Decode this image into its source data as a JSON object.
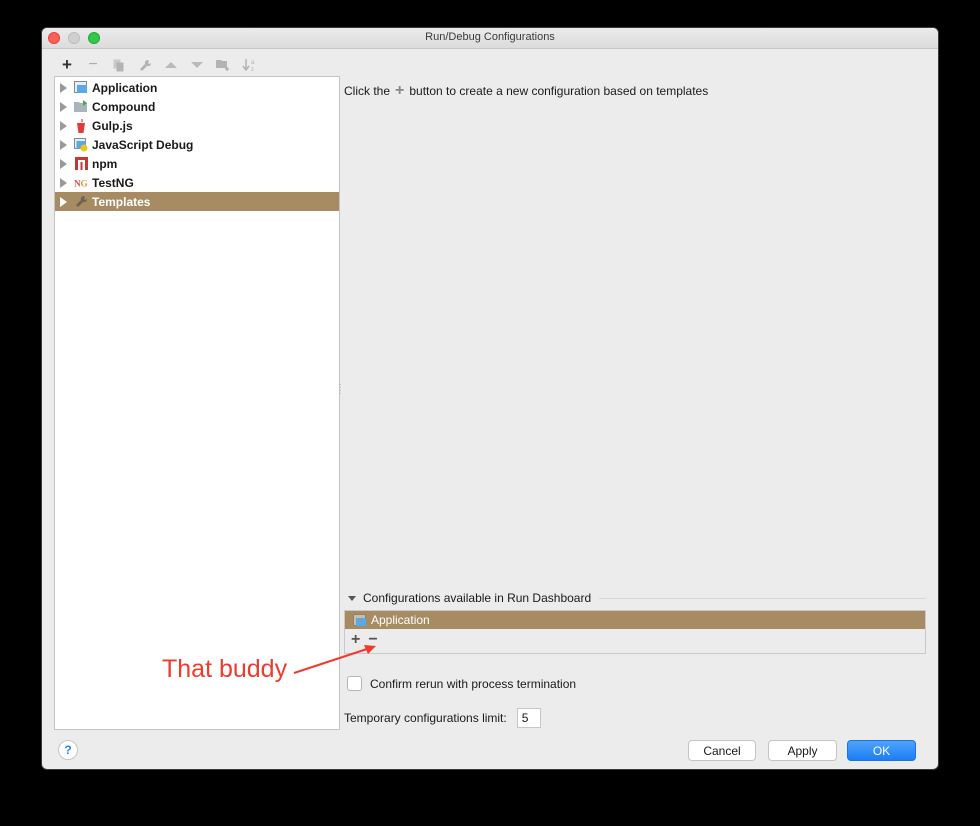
{
  "window": {
    "title": "Run/Debug Configurations"
  },
  "toolbar": {
    "buttons": [
      {
        "icon": "plus-icon",
        "glyph": "+",
        "label": "Add New Configuration"
      },
      {
        "icon": "minus-icon",
        "glyph": "−",
        "label": "Remove Configuration"
      },
      {
        "icon": "copy-icon",
        "glyph": "⧉",
        "label": "Copy Configuration"
      },
      {
        "icon": "wrench-icon",
        "glyph": "🔧",
        "label": "Edit Templates"
      },
      {
        "icon": "arrow-up-icon",
        "glyph": "▲",
        "label": "Move Up"
      },
      {
        "icon": "arrow-down-icon",
        "glyph": "▼",
        "label": "Move Down"
      },
      {
        "icon": "folder-add-icon",
        "glyph": "▰",
        "label": "Create New Folder"
      },
      {
        "icon": "sort-az-icon",
        "glyph": "↓ᵃᶻ",
        "label": "Sort Alphabetically"
      }
    ]
  },
  "tree": {
    "items": [
      {
        "label": "Application",
        "icon": "application-icon"
      },
      {
        "label": "Compound",
        "icon": "compound-icon"
      },
      {
        "label": "Gulp.js",
        "icon": "gulp-icon"
      },
      {
        "label": "JavaScript Debug",
        "icon": "javascript-debug-icon"
      },
      {
        "label": "npm",
        "icon": "npm-icon"
      },
      {
        "label": "TestNG",
        "icon": "testng-icon"
      },
      {
        "label": "Templates",
        "icon": "wrench-icon",
        "selected": true
      }
    ]
  },
  "main": {
    "hint_before": "Click the",
    "hint_plus": "+",
    "hint_after": "button to create a new configuration based on templates"
  },
  "dashboard": {
    "section_label": "Configurations available in Run Dashboard",
    "items": [
      {
        "label": "Application",
        "selected": true
      }
    ],
    "add_glyph": "+",
    "remove_glyph": "−"
  },
  "annotation": {
    "text": "That buddy",
    "color": "#f03a2e"
  },
  "options": {
    "confirm_rerun_label": "Confirm rerun with process termination",
    "confirm_rerun_checked": false,
    "temp_limit_label": "Temporary configurations limit:",
    "temp_limit_value": "5"
  },
  "footer": {
    "help_glyph": "?",
    "cancel_label": "Cancel",
    "apply_label": "Apply",
    "ok_label": "OK"
  },
  "colors": {
    "selection": "#a78b63",
    "primary": "#1c7ef4"
  }
}
